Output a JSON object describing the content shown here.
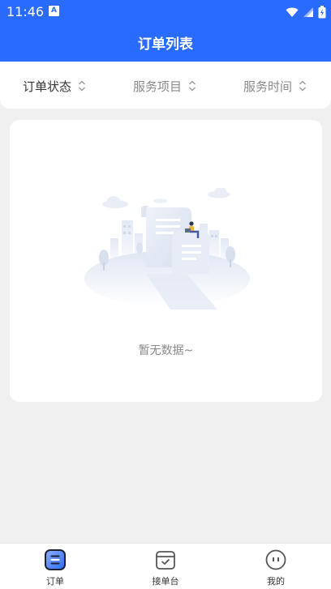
{
  "status_bar": {
    "time": "11:46",
    "notification_letter": "A"
  },
  "header": {
    "title": "订单列表"
  },
  "filters": [
    {
      "label": "订单状态",
      "icon": "sort-icon"
    },
    {
      "label": "服务项目",
      "icon": "sort-icon"
    },
    {
      "label": "服务时间",
      "icon": "sort-icon"
    }
  ],
  "empty_state": {
    "message": "暂无数据~",
    "illustration": "empty-city-illustration"
  },
  "tabs": [
    {
      "label": "订单",
      "icon": "order-list-icon",
      "active": true
    },
    {
      "label": "接单台",
      "icon": "calendar-check-icon",
      "active": false
    },
    {
      "label": "我的",
      "icon": "profile-face-icon",
      "active": false
    }
  ],
  "colors": {
    "primary": "#2a6bff",
    "background": "#f0f0f0",
    "muted_text": "#8a8a8a"
  }
}
